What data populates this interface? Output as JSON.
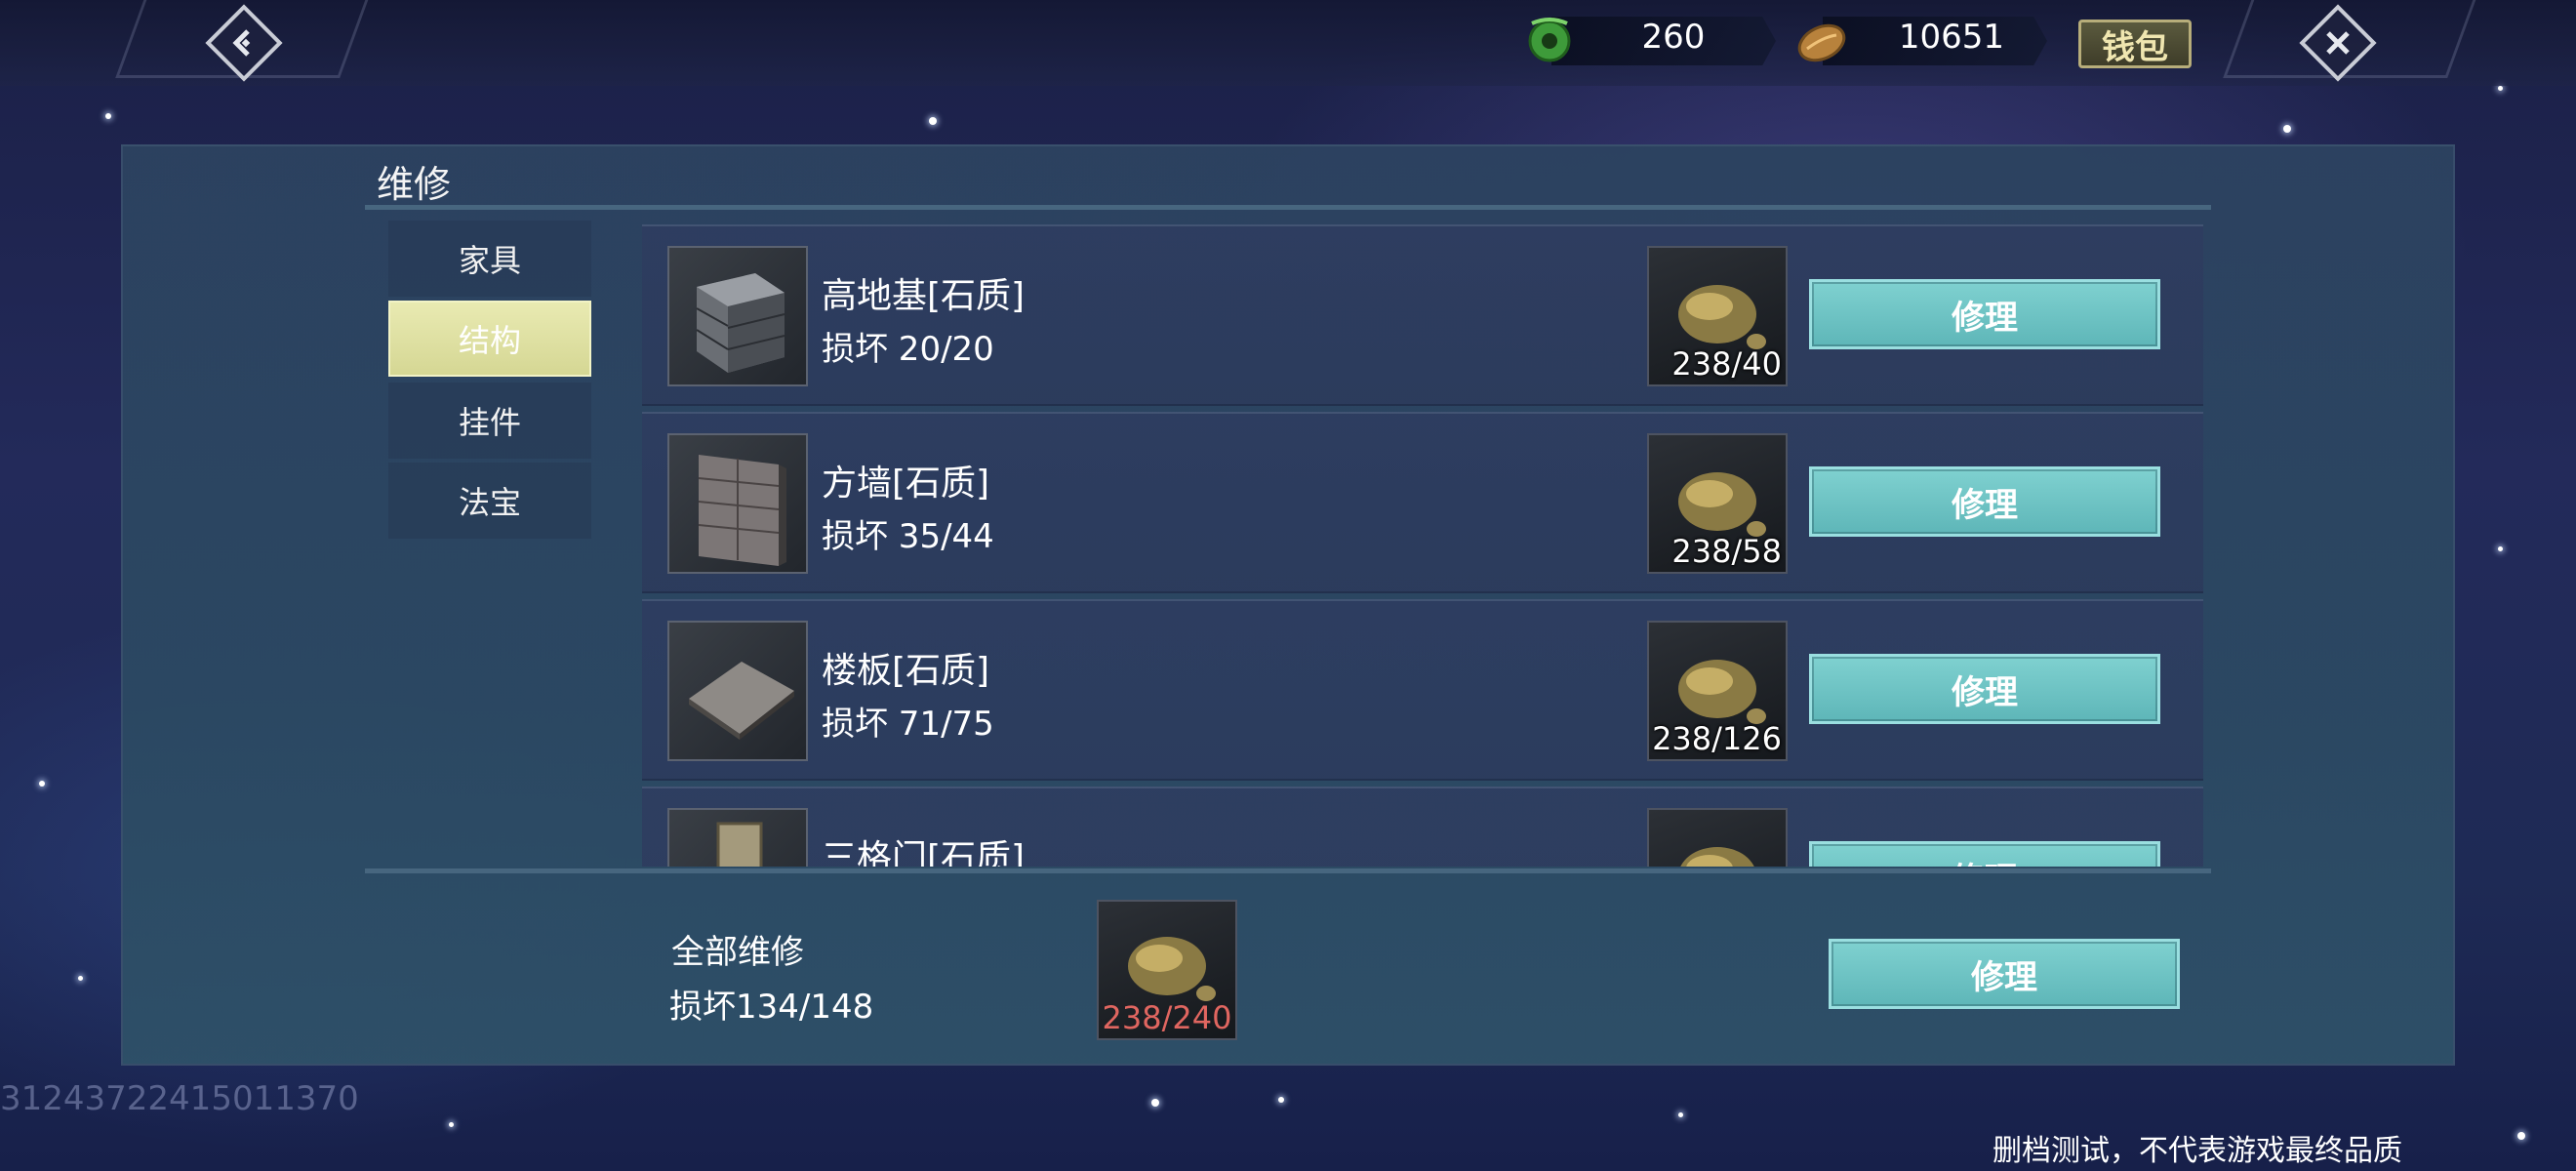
{
  "topbar": {
    "jade_amount": "260",
    "coin_amount": "10651",
    "wallet_label": "钱包"
  },
  "panel": {
    "title": "维修",
    "tabs": [
      {
        "label": "家具",
        "active": false
      },
      {
        "label": "结构",
        "active": true
      },
      {
        "label": "挂件",
        "active": false
      },
      {
        "label": "法宝",
        "active": false
      }
    ],
    "items": [
      {
        "name": "高地基[石质]",
        "damage": "损坏 20/20",
        "cost": "238/40",
        "button": "修理"
      },
      {
        "name": "方墙[石质]",
        "damage": "损坏 35/44",
        "cost": "238/58",
        "button": "修理"
      },
      {
        "name": "楼板[石质]",
        "damage": "损坏 71/75",
        "cost": "238/126",
        "button": "修理"
      },
      {
        "name": "三格门[石质]",
        "damage": "",
        "cost": "",
        "button": "修理"
      }
    ],
    "repair_all": {
      "title": "全部维修",
      "damage": "损坏134/148",
      "cost": "238/240",
      "button": "修理"
    }
  },
  "build_id": "31243722415011370",
  "footer_note": "删档测试，不代表游戏最终品质"
}
